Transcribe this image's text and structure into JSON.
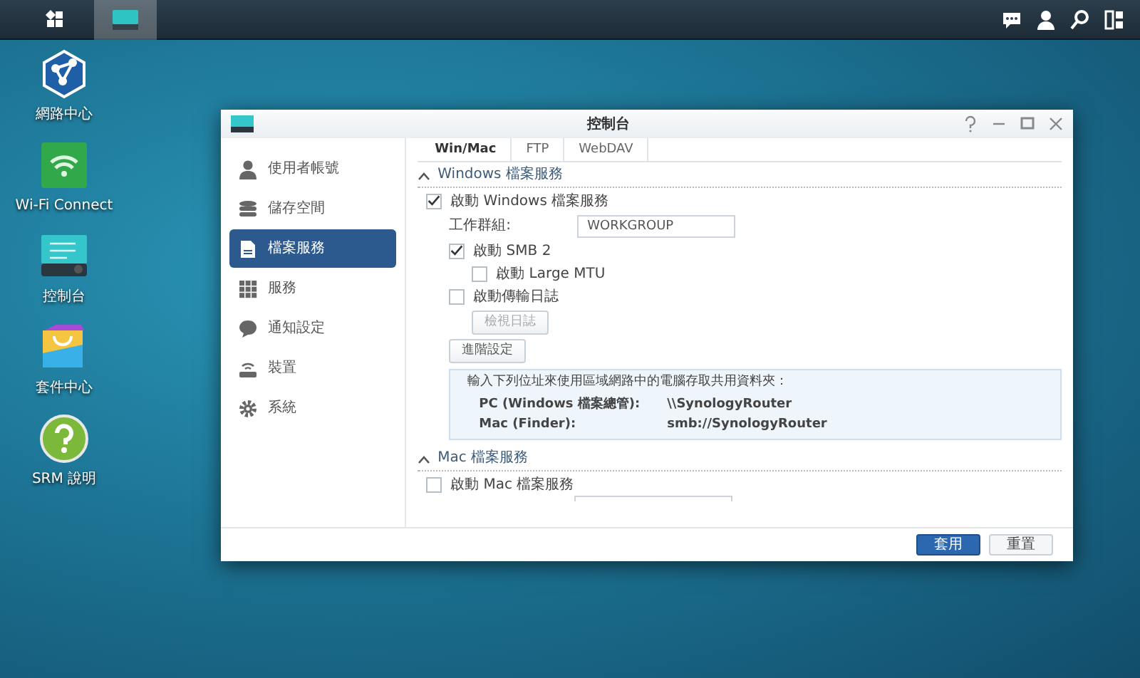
{
  "taskbar": {
    "items": [
      {
        "kind": "main-menu",
        "selected": false
      },
      {
        "kind": "control-panel",
        "selected": true
      }
    ]
  },
  "desktop_icons": [
    {
      "kind": "network",
      "label": "網路中心"
    },
    {
      "kind": "wifi",
      "label": "Wi-Fi Connect"
    },
    {
      "kind": "control-panel",
      "label": "控制台"
    },
    {
      "kind": "package",
      "label": "套件中心"
    },
    {
      "kind": "help",
      "label": "SRM 說明"
    }
  ],
  "window": {
    "title": "控制台",
    "sidebar": [
      {
        "kind": "user",
        "label": "使用者帳號",
        "selected": false
      },
      {
        "kind": "storage",
        "label": "儲存空間",
        "selected": false
      },
      {
        "kind": "file",
        "label": "檔案服務",
        "selected": true
      },
      {
        "kind": "services",
        "label": "服務",
        "selected": false
      },
      {
        "kind": "chat",
        "label": "通知設定",
        "selected": false
      },
      {
        "kind": "router",
        "label": "裝置",
        "selected": false
      },
      {
        "kind": "gear",
        "label": "系統",
        "selected": false
      }
    ],
    "tabs": [
      {
        "label": "Win/Mac",
        "selected": true
      },
      {
        "label": "FTP",
        "selected": false
      },
      {
        "label": "WebDAV",
        "selected": false
      }
    ],
    "windows_section": {
      "title": "Windows 檔案服務",
      "expanded": true,
      "enable": {
        "label": "啟動 Windows 檔案服務",
        "checked": true
      },
      "workgroup": {
        "label": "工作群組:",
        "value": "WORKGROUP"
      },
      "smb2": {
        "label": "啟動 SMB 2",
        "checked": true
      },
      "large_mtu": {
        "label": "啟動 Large MTU",
        "checked": false
      },
      "transfer_log": {
        "label": "啟動傳輸日誌",
        "checked": false
      },
      "view_log": {
        "label": "檢視日誌",
        "disabled": true
      },
      "advanced": {
        "label": "進階設定",
        "disabled": false
      },
      "info": {
        "text": "輸入下列位址來使用區域網路中的電腦存取共用資料夾：",
        "rows": [
          {
            "label": "PC (Windows 檔案總管):",
            "value": "\\\\SynologyRouter"
          },
          {
            "label": "Mac (Finder):",
            "value": "smb://SynologyRouter"
          }
        ]
      }
    },
    "mac_section": {
      "title": "Mac 檔案服務",
      "expanded": true,
      "enable": {
        "label": "啟動 Mac 檔案服務",
        "checked": false
      }
    },
    "buttons": [
      {
        "kind": "primary",
        "label": "套用"
      },
      {
        "kind": "secondary",
        "label": "重置"
      }
    ]
  }
}
